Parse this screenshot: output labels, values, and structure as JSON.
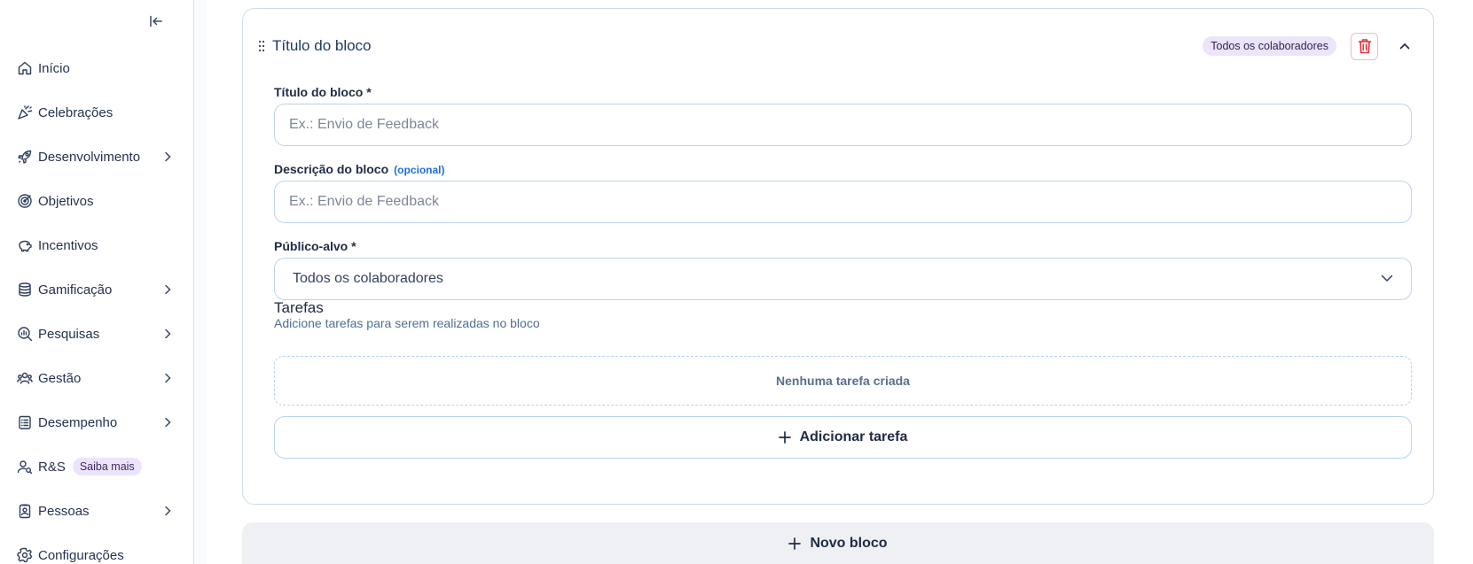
{
  "sidebar": {
    "items": [
      {
        "label": "Início",
        "icon": "home-icon",
        "has_chevron": false
      },
      {
        "label": "Celebrações",
        "icon": "party-popper-icon",
        "has_chevron": false
      },
      {
        "label": "Desenvolvimento",
        "icon": "rocket-icon",
        "has_chevron": true
      },
      {
        "label": "Objetivos",
        "icon": "target-icon",
        "has_chevron": false
      },
      {
        "label": "Incentivos",
        "icon": "piggy-bank-icon",
        "has_chevron": false
      },
      {
        "label": "Gamificação",
        "icon": "coins-icon",
        "has_chevron": true
      },
      {
        "label": "Pesquisas",
        "icon": "search-chart-icon",
        "has_chevron": true
      },
      {
        "label": "Gestão",
        "icon": "users-icon",
        "has_chevron": true
      },
      {
        "label": "Desempenho",
        "icon": "clipboard-list-icon",
        "has_chevron": true
      },
      {
        "label": "R&S",
        "icon": "user-search-icon",
        "has_chevron": false,
        "badge": "Saiba mais"
      },
      {
        "label": "Pessoas",
        "icon": "id-badge-icon",
        "has_chevron": true
      },
      {
        "label": "Configurações",
        "icon": "gear-icon",
        "has_chevron": false
      }
    ]
  },
  "block": {
    "title": "Título do bloco",
    "audience_badge": "Todos os colaboradores",
    "fields": {
      "title_label": "Título do bloco  *",
      "title_placeholder": "Ex.: Envio de Feedback",
      "description_label": "Descrição do bloco",
      "description_optional": "(opcional)",
      "description_placeholder": "Ex.: Envio de Feedback",
      "audience_label": "Público-alvo *",
      "audience_value": "Todos os colaboradores"
    },
    "tasks": {
      "title": "Tarefas",
      "subtitle": "Adicione tarefas para serem realizadas no bloco",
      "empty_text": "Nenhuma tarefa criada",
      "add_label": "Adicionar tarefa"
    }
  },
  "new_block_label": "Novo bloco",
  "colors": {
    "accent_blue": "#1f6fd1",
    "badge_purple_bg": "#ece4fb",
    "danger_red": "#e0333f",
    "border_blue": "#bcd4ee"
  }
}
